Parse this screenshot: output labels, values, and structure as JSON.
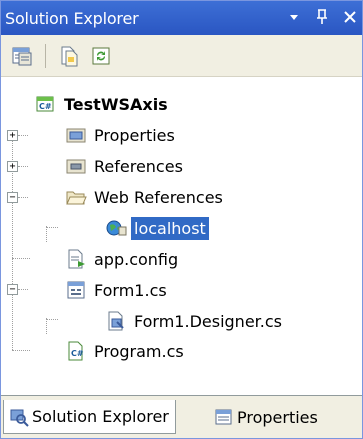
{
  "window": {
    "title": "Solution Explorer",
    "controls": {
      "dropdown": "▾",
      "pin": "ᚹ",
      "close": "✕"
    }
  },
  "toolbar": {
    "buttons": [
      "properties-button",
      "show-all-files-button",
      "refresh-button"
    ]
  },
  "tree": {
    "project": "TestWSAxis",
    "items": [
      {
        "label": "Properties",
        "icon": "properties-folder-icon"
      },
      {
        "label": "References",
        "icon": "references-folder-icon"
      },
      {
        "label": "Web References",
        "icon": "open-folder-icon"
      },
      {
        "label": "localhost",
        "icon": "web-reference-globe-icon"
      },
      {
        "label": "app.config",
        "icon": "config-file-icon"
      },
      {
        "label": "Form1.cs",
        "icon": "form-icon"
      },
      {
        "label": "Form1.Designer.cs",
        "icon": "designer-file-icon"
      },
      {
        "label": "Program.cs",
        "icon": "csharp-file-icon"
      }
    ],
    "expanders": {
      "collapsed": "+",
      "expanded": "−"
    }
  },
  "bottom_tabs": [
    "Solution Explorer",
    "Properties"
  ],
  "colors": {
    "title_bar": "#2a56c2",
    "selection": "#316ac5",
    "toolbar_bg": "#f1efe2"
  }
}
